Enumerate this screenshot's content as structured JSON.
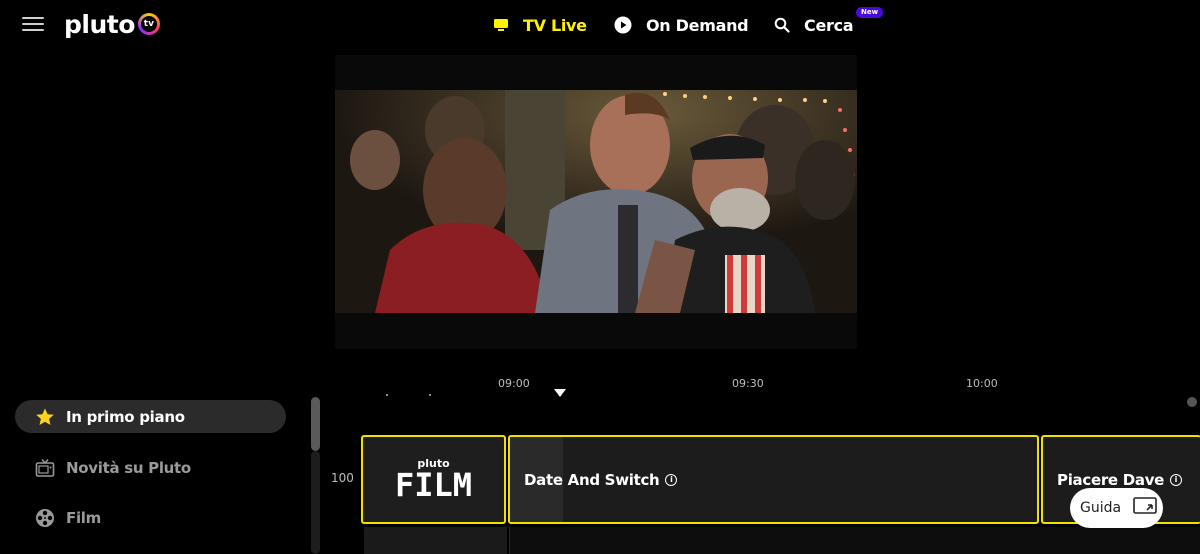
{
  "header": {
    "logo_text": "pluto",
    "logo_badge": "tv",
    "nav": {
      "live": "TV Live",
      "on_demand": "On Demand",
      "search": "Cerca",
      "search_badge": "New"
    }
  },
  "timeline": {
    "times": [
      "09:00",
      "09:30",
      "10:00"
    ]
  },
  "sidebar": {
    "categories": [
      {
        "label": "In primo piano",
        "icon": "star-icon",
        "active": true
      },
      {
        "label": "Novità su Pluto",
        "icon": "tv-icon",
        "active": false
      },
      {
        "label": "Film",
        "icon": "film-reel-icon",
        "active": false
      }
    ]
  },
  "guide": {
    "channel_number": "100",
    "channel_brand": "pluto",
    "channel_name": "FILM",
    "programs": [
      {
        "title": "Date And Switch",
        "progress": 0.1
      },
      {
        "title": "Piacere Dave"
      }
    ],
    "guida_button": "Guida"
  },
  "colors": {
    "accent": "#fff200",
    "badge": "#4a0bd8",
    "active_category_bg": "#2b2b2b"
  }
}
